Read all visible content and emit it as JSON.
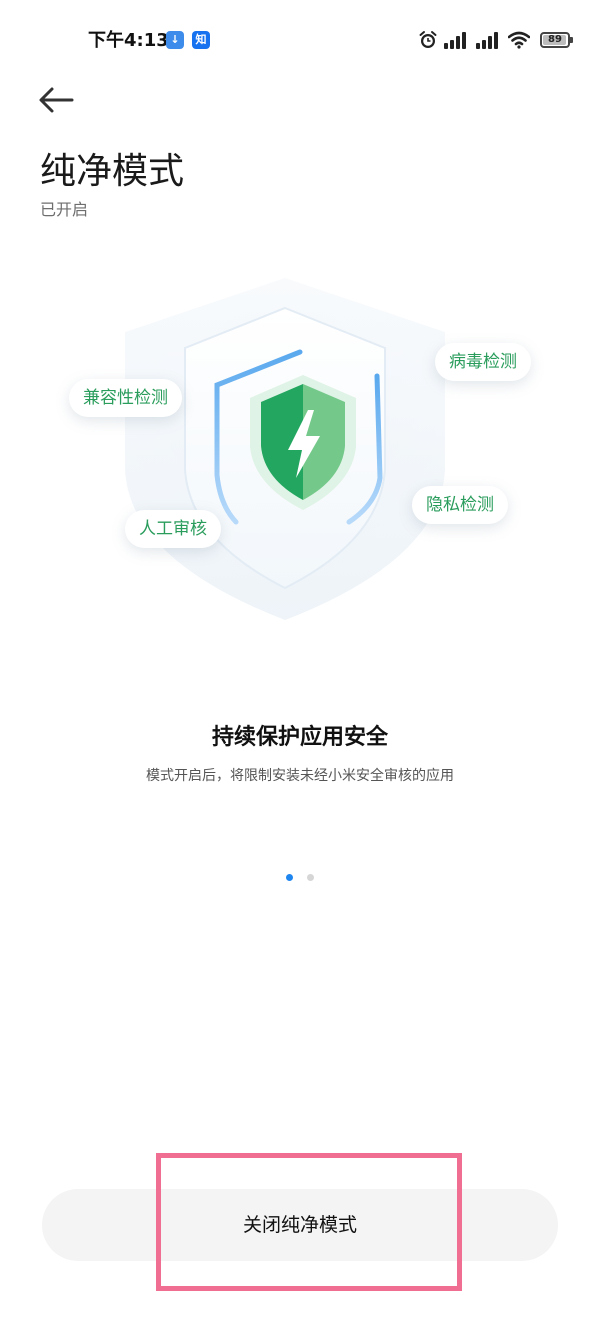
{
  "status_bar": {
    "time": "下午4:13",
    "app_icon_download": "↓",
    "app_icon_zhihu": "知",
    "battery_level": "89",
    "battery_fraction": 0.89
  },
  "header": {
    "title": "纯净模式",
    "subtitle": "已开启"
  },
  "illustration": {
    "chips": {
      "virus": "病毒检测",
      "compatibility": "兼容性检测",
      "privacy": "隐私检测",
      "manual": "人工审核"
    }
  },
  "content": {
    "headline": "持续保护应用安全",
    "description": "模式开启后，将限制安装未经小米安全审核的应用"
  },
  "pager": {
    "total_pages": 2,
    "current_page": 1
  },
  "actions": {
    "close_label": "关闭纯净模式"
  },
  "colors": {
    "accent_green": "#2a9d5c",
    "shield_green": "#23a65f",
    "shield_light_green": "#74c98a",
    "accent_blue": "#5aa9ee",
    "dot_active": "#1f86f0",
    "dot_inactive": "#d6d6d6",
    "highlight": "#f06e92"
  },
  "icons": {
    "back": "arrow-left-icon",
    "alarm": "alarm-clock-icon",
    "signal": "cellular-signal-icon",
    "wifi": "wifi-icon",
    "battery": "battery-icon",
    "shield": "shield-lightning-icon"
  }
}
